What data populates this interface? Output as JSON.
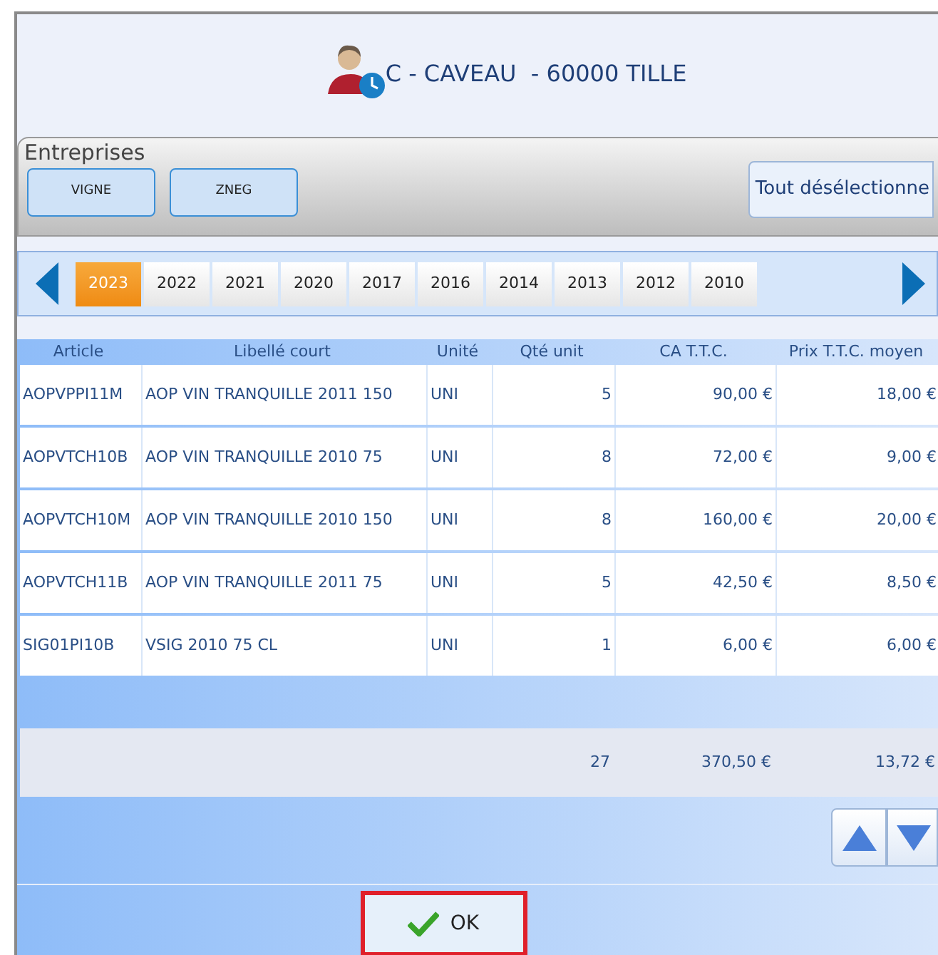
{
  "header": {
    "title": "C - CAVEAU  - 60000 TILLE"
  },
  "companies": {
    "title": "Entreprises",
    "buttons": [
      "VIGNE",
      "ZNEG"
    ],
    "deselect_all": "Tout désélectionne"
  },
  "years": [
    {
      "label": "2023",
      "selected": true
    },
    {
      "label": "2022",
      "selected": false
    },
    {
      "label": "2021",
      "selected": false
    },
    {
      "label": "2020",
      "selected": false
    },
    {
      "label": "2017",
      "selected": false
    },
    {
      "label": "2016",
      "selected": false
    },
    {
      "label": "2014",
      "selected": false
    },
    {
      "label": "2013",
      "selected": false
    },
    {
      "label": "2012",
      "selected": false
    },
    {
      "label": "2010",
      "selected": false
    }
  ],
  "table": {
    "columns": [
      "Article",
      "Libellé court",
      "Unité",
      "Qté unit",
      "CA T.T.C.",
      "Prix T.T.C. moyen"
    ],
    "rows": [
      [
        "AOPVPPI11M",
        "AOP VIN TRANQUILLE 2011 150",
        "UNI",
        "5",
        "90,00 €",
        "18,00 €"
      ],
      [
        "AOPVTCH10B",
        "AOP VIN TRANQUILLE 2010 75",
        "UNI",
        "8",
        "72,00 €",
        "9,00 €"
      ],
      [
        "AOPVTCH10M",
        "AOP VIN TRANQUILLE 2010 150",
        "UNI",
        "8",
        "160,00 €",
        "20,00 €"
      ],
      [
        "AOPVTCH11B",
        "AOP VIN TRANQUILLE 2011 75",
        "UNI",
        "5",
        "42,50 €",
        "8,50 €"
      ],
      [
        "SIG01PI10B",
        "VSIG 2010 75 CL",
        "UNI",
        "1",
        "6,00 €",
        "6,00 €"
      ]
    ],
    "totals": {
      "qty": "27",
      "revenue": "370,50 €",
      "average_price": "13,72 €"
    }
  },
  "ok_button": "OK"
}
